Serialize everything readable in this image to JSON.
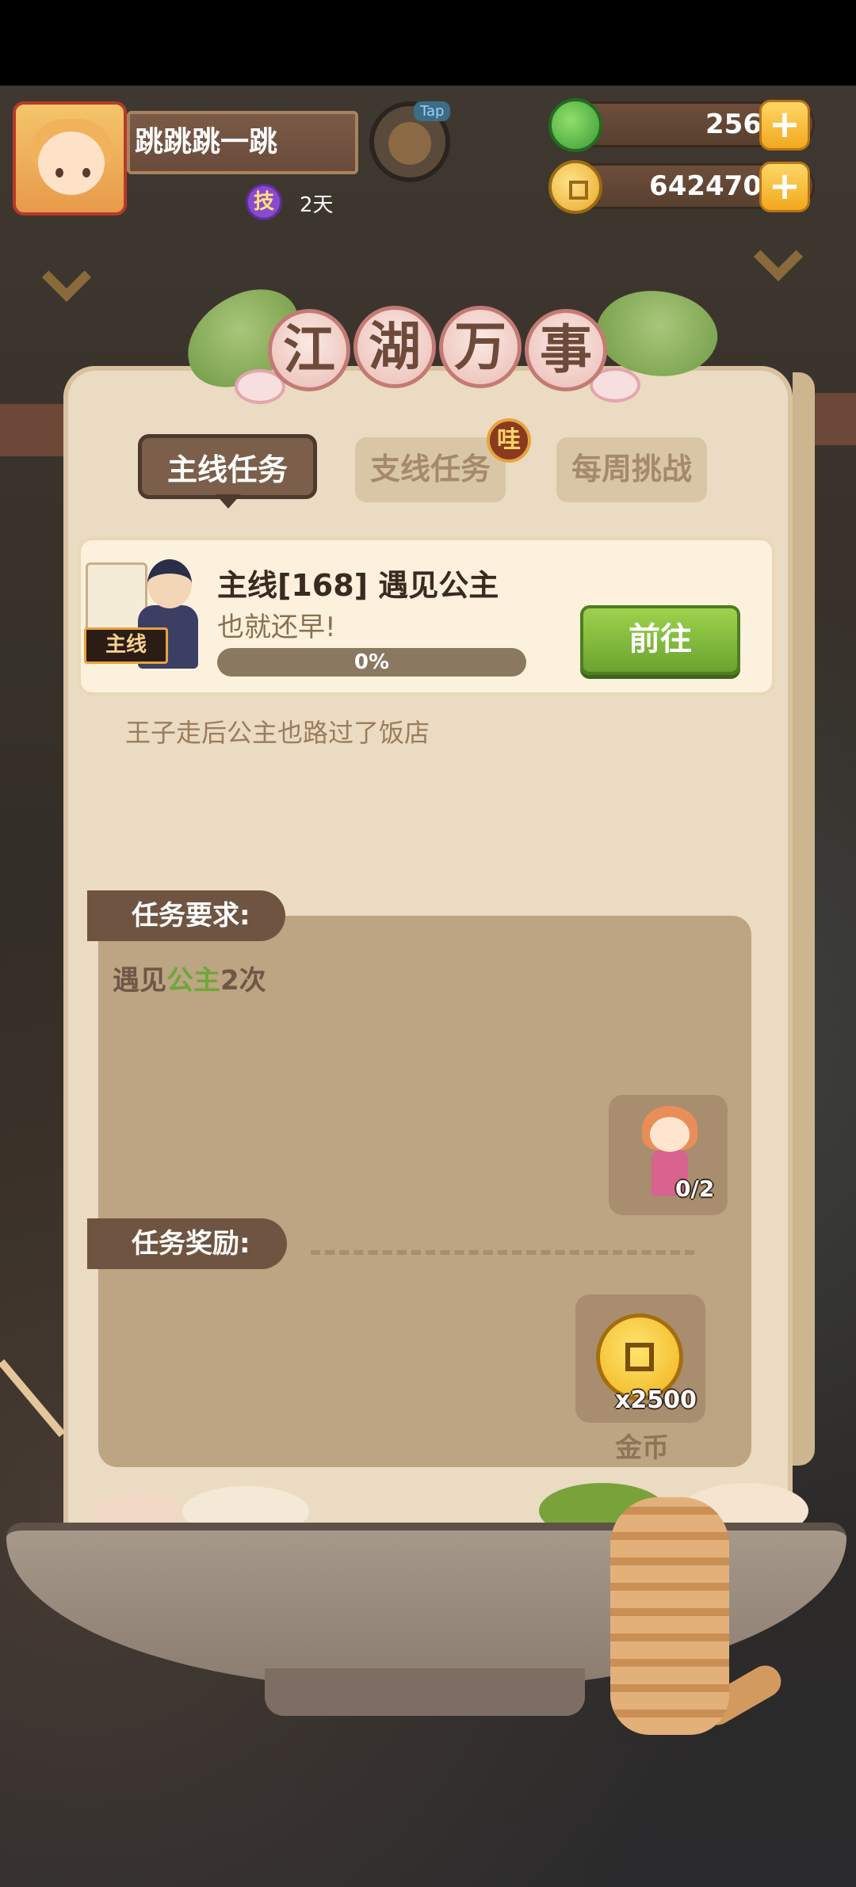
{
  "player": {
    "name": "跳跳跳一跳",
    "skill_badge": "技",
    "skill_days": "2天",
    "tap_hint": "Tap"
  },
  "currencies": {
    "jade": {
      "value": "256",
      "icon": "jade-icon",
      "plus": "+"
    },
    "coins": {
      "value": "642470",
      "icon": "gold-coin-icon",
      "plus": "+"
    }
  },
  "panel": {
    "title_chars": [
      "江",
      "湖",
      "万",
      "事"
    ],
    "tabs": [
      {
        "label": "主线任务",
        "active": true
      },
      {
        "label": "支线任务",
        "active": false,
        "badge": "哇"
      },
      {
        "label": "每周挑战",
        "active": false
      }
    ]
  },
  "quest": {
    "tag": "主线",
    "title": "主线[168] 遇见公主",
    "subtitle": "也就还早!",
    "progress_text": "0%",
    "progress_value": 0,
    "go_button": "前往",
    "description": "王子走后公主也路过了饭店"
  },
  "requirement": {
    "label": "任务要求:",
    "text_before": "遇见",
    "text_highlight": "公主",
    "text_after": "2次",
    "target_count": "0/2"
  },
  "reward": {
    "label": "任务奖励:",
    "quantity": "x2500",
    "name": "金币"
  },
  "colors": {
    "accent_green": "#6da83a",
    "button_green": "#8cc43e",
    "panel_bg": "#eadbc2",
    "tab_active": "#7b5f4a"
  }
}
